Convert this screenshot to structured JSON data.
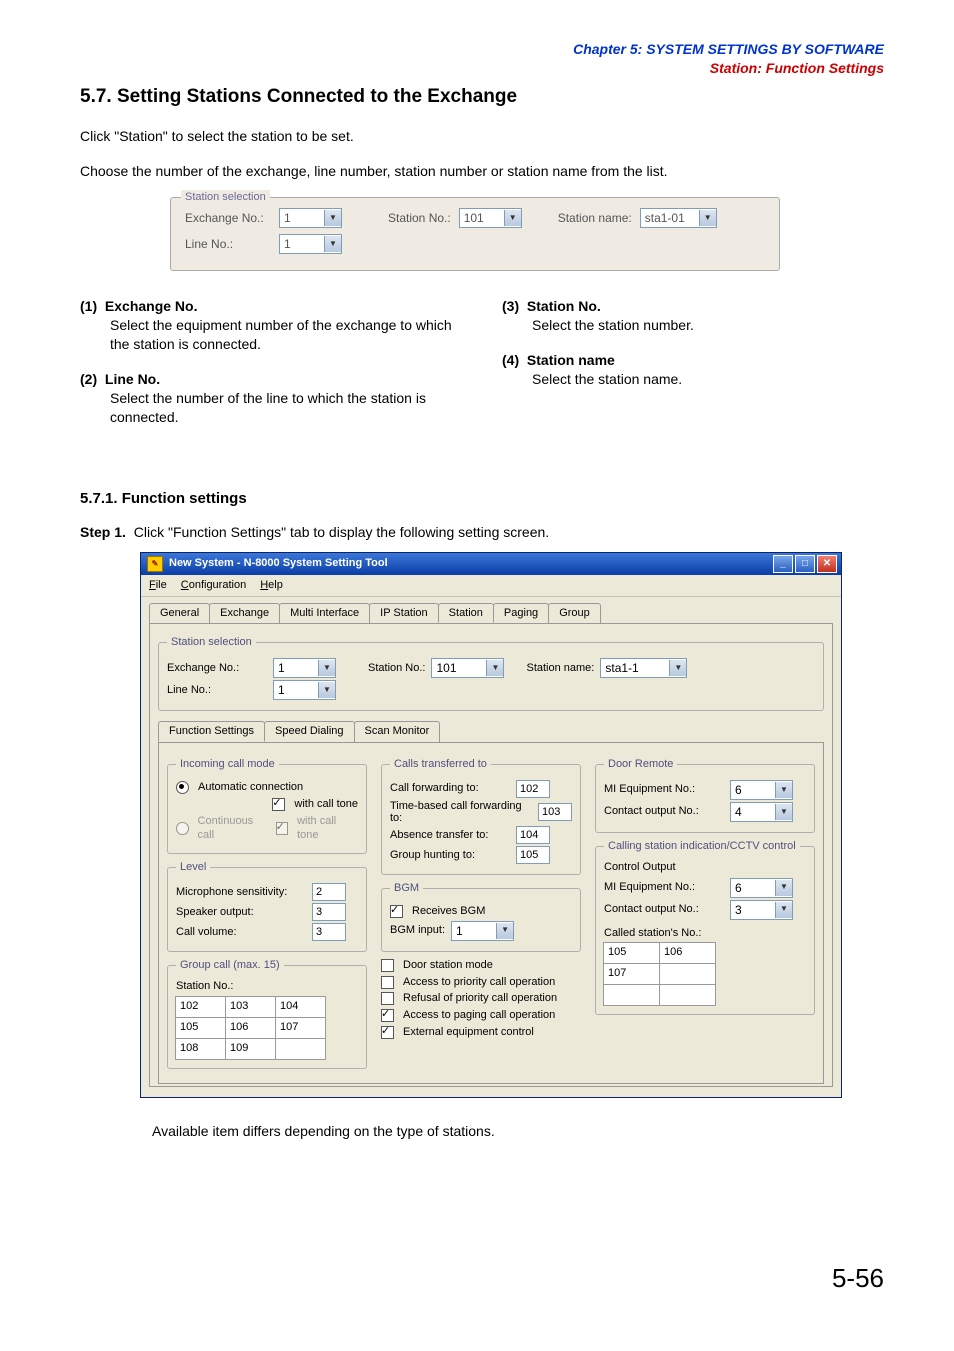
{
  "header": {
    "chapter": "Chapter 5:  SYSTEM SETTINGS BY SOFTWARE",
    "section": "Station: Function Settings"
  },
  "title": "5.7. Setting Stations Connected to the Exchange",
  "intro1": "Click \"Station\" to select the station to be set.",
  "intro2": "Choose the number of the exchange, line number, station number or station name from the list.",
  "fig1": {
    "legend": "Station selection",
    "exchange_label": "Exchange No.:",
    "exchange_val": "1",
    "line_label": "Line No.:",
    "line_val": "1",
    "station_no_label": "Station No.:",
    "station_no_val": "101",
    "station_name_label": "Station name:",
    "station_name_val": "sta1-01"
  },
  "defs": {
    "d1_num": "(1)",
    "d1_head": "Exchange No.",
    "d1_body": "Select the equipment number of the exchange to which the station is connected.",
    "d2_num": "(2)",
    "d2_head": "Line No.",
    "d2_body": "Select the number of the line to which the station is connected.",
    "d3_num": "(3)",
    "d3_head": "Station No.",
    "d3_body": "Select the station number.",
    "d4_num": "(4)",
    "d4_head": "Station name",
    "d4_body": "Select the station name."
  },
  "subhead": "5.7.1. Function settings",
  "step1_label": "Step 1.",
  "step1_text": "Click \"Function Settings\" tab to display the following setting screen.",
  "app": {
    "title": "New System - N-8000 System Setting Tool",
    "menu": {
      "file": "File",
      "config": "Configuration",
      "help": "Help"
    },
    "tabs": {
      "general": "General",
      "exchange": "Exchange",
      "multi": "Multi Interface",
      "ip": "IP Station",
      "station": "Station",
      "paging": "Paging",
      "group": "Group"
    },
    "sel": {
      "legend": "Station selection",
      "exch_label": "Exchange No.:",
      "exch_val": "1",
      "line_label": "Line No.:",
      "line_val": "1",
      "stno_label": "Station No.:",
      "stno_val": "101",
      "stname_label": "Station name:",
      "stname_val": "sta1-1"
    },
    "subtabs": {
      "func": "Function Settings",
      "speed": "Speed Dialing",
      "scan": "Scan Monitor"
    },
    "incoming": {
      "legend": "Incoming call mode",
      "auto": "Automatic connection",
      "with_tone": "with call tone",
      "cont": "Continuous call",
      "with_tone2": "with call tone"
    },
    "level": {
      "legend": "Level",
      "mic_label": "Microphone sensitivity:",
      "mic_val": "2",
      "spk_label": "Speaker output:",
      "spk_val": "3",
      "vol_label": "Call volume:",
      "vol_val": "3"
    },
    "groupcall": {
      "legend": "Group call (max. 15)",
      "stno_label": "Station No.:",
      "cells": [
        "102",
        "103",
        "104",
        "105",
        "106",
        "107",
        "108",
        "109",
        ""
      ]
    },
    "transfer": {
      "legend": "Calls transferred to",
      "cf_label": "Call forwarding to:",
      "cf_val": "102",
      "tb_label": "Time-based call forwarding to:",
      "tb_val": "103",
      "abs_label": "Absence transfer to:",
      "abs_val": "104",
      "gh_label": "Group hunting to:",
      "gh_val": "105"
    },
    "bgm": {
      "legend": "BGM",
      "recv": "Receives BGM",
      "input_label": "BGM input:",
      "input_val": "1"
    },
    "opts": {
      "door": "Door station mode",
      "acc_prio": "Access to priority call operation",
      "ref_prio": "Refusal of priority call operation",
      "acc_page": "Access to paging call operation",
      "ext_ctrl": "External equipment control"
    },
    "door": {
      "legend": "Door Remote",
      "mi_label": "MI Equipment No.:",
      "mi_val": "6",
      "co_label": "Contact output No.:",
      "co_val": "4"
    },
    "cctv": {
      "legend": "Calling station indication/CCTV control",
      "ctrl_out": "Control Output",
      "mi_label": "MI Equipment No.:",
      "mi_val": "6",
      "co_label": "Contact output No.:",
      "co_val": "3",
      "called_label": "Called station's No.:",
      "cells": [
        "105",
        "106",
        "107",
        "",
        "",
        ""
      ]
    }
  },
  "footnote": "Available item differs depending on the type of stations.",
  "page_number": "5-56"
}
